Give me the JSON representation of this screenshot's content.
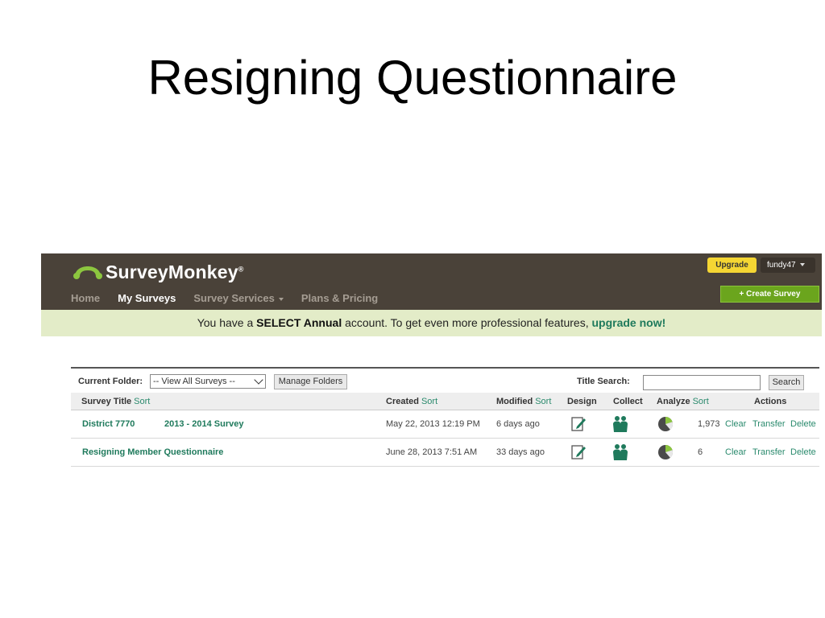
{
  "slide": {
    "title": "Resigning Questionnaire"
  },
  "header": {
    "brand": "SurveyMonkey",
    "registered": "®",
    "nav": [
      {
        "label": "Home",
        "active": false
      },
      {
        "label": "My Surveys",
        "active": true
      },
      {
        "label": "Survey Services",
        "active": false,
        "has_dropdown": true
      },
      {
        "label": "Plans & Pricing",
        "active": false
      }
    ],
    "upgrade_label": "Upgrade",
    "username": "fundy47",
    "create_label": "+ Create Survey",
    "colors": {
      "bar": "#4a4239",
      "upgrade": "#f5d633",
      "create": "#6ba51d",
      "brand_icon": "#8cc63f"
    }
  },
  "banner": {
    "text_before": "You have a ",
    "plan": "SELECT Annual",
    "text_middle": " account. To get even more professional features, ",
    "link": "upgrade now!"
  },
  "toolbar": {
    "folder_label": "Current Folder:",
    "folder_value": "-- View All Surveys --",
    "manage_folders": "Manage Folders",
    "search_label": "Title Search:",
    "search_value": "",
    "search_button": "Search"
  },
  "table": {
    "headers": {
      "title": "Survey Title",
      "created": "Created",
      "modified": "Modified",
      "design": "Design",
      "collect": "Collect",
      "analyze": "Analyze",
      "actions": "Actions",
      "sort": "Sort"
    },
    "rows": [
      {
        "folder": "District 7770",
        "title": "2013 - 2014 Survey",
        "created": "May 22, 2013 12:19 PM",
        "modified": "6 days ago",
        "responses": "1,973",
        "clear": "Clear",
        "transfer": "Transfer",
        "delete": "Delete"
      },
      {
        "folder": "",
        "title": "Resigning Member Questionnaire",
        "created": "June 28, 2013 7:51 AM",
        "modified": "33 days ago",
        "responses": "6",
        "clear": "Clear",
        "transfer": "Transfer",
        "delete": "Delete"
      }
    ]
  },
  "icons": {
    "logo": "surveymonkey-logo-icon",
    "design": "edit-document-icon",
    "collect": "people-icon",
    "analyze": "pie-chart-icon",
    "accent": "#1f7a5c"
  }
}
